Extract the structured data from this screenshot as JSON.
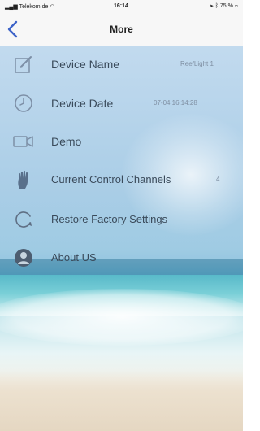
{
  "status_bar": {
    "carrier": "Telekom.de",
    "time": "16:14",
    "battery": "75 %"
  },
  "nav": {
    "title": "More",
    "back_icon": "chevron-left-icon"
  },
  "menu": [
    {
      "label": "Device Name",
      "value": "ReefLight 1",
      "icon": "edit-icon"
    },
    {
      "label": "Device Date",
      "value": "07-04 16:14:28",
      "icon": "clock-icon"
    },
    {
      "label": "Demo",
      "value": "",
      "icon": "video-camera-icon"
    },
    {
      "label": "Current Control Channels",
      "value": "4",
      "icon": "hand-icon"
    },
    {
      "label": "Restore Factory Settings",
      "value": "",
      "icon": "refresh-icon"
    },
    {
      "label": "About US",
      "value": "",
      "icon": "user-icon"
    }
  ],
  "colors": {
    "accent": "#3d63c8",
    "label": "#3a4a5a",
    "value": "#7f8fa2",
    "navbar": "#f7f7f7"
  }
}
